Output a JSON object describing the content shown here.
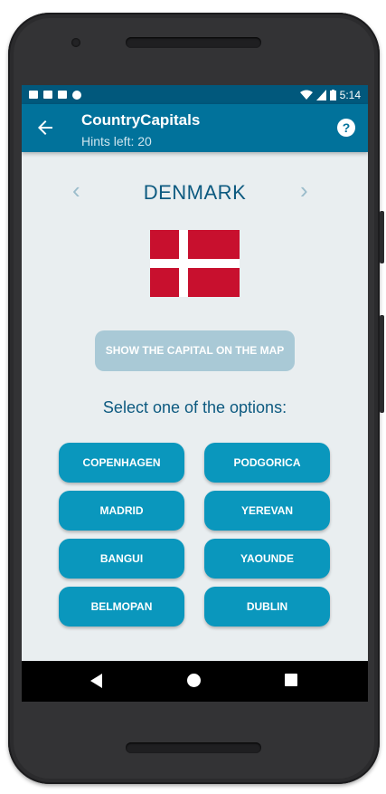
{
  "status_bar": {
    "time": "5:14",
    "icons": [
      "a-icon",
      "play-icon",
      "sd-card-icon",
      "circle-icon"
    ],
    "right_icons": [
      "wifi-icon",
      "signal-icon",
      "battery-icon"
    ]
  },
  "app_bar": {
    "title": "CountryCapitals",
    "subtitle": "Hints left: 20",
    "back_icon": "arrow-left-icon",
    "help_icon": "help-icon",
    "help_glyph": "?"
  },
  "quiz": {
    "country": "DENMARK",
    "prev_arrow": "‹",
    "next_arrow": "›",
    "flag": {
      "name": "denmark-flag",
      "colors": {
        "field": "#c8102e",
        "cross": "#ffffff"
      }
    },
    "map_button": "SHOW THE CAPITAL ON THE MAP",
    "prompt": "Select one of the options:",
    "options": [
      "COPENHAGEN",
      "PODGORICA",
      "MADRID",
      "YEREVAN",
      "BANGUI",
      "YAOUNDE",
      "BELMOPAN",
      "DUBLIN"
    ]
  },
  "colors": {
    "status_bar": "#01587c",
    "app_bar": "#01729b",
    "option_button": "#0a97bd",
    "disabled_button": "#a9c9d6",
    "text_accent": "#0d5a80",
    "background": "#e9eef0"
  },
  "nav_bar": {
    "icons": [
      "back-icon",
      "home-icon",
      "recents-icon"
    ]
  }
}
